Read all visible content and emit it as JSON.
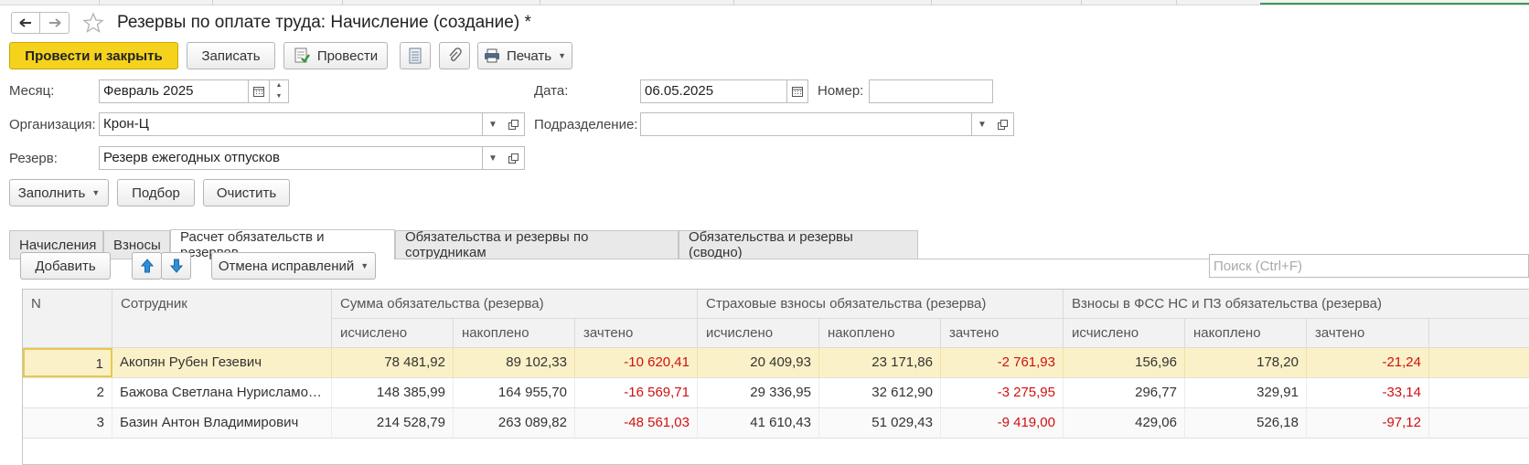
{
  "window": {
    "title": "Резервы по оплате труда: Начисление (создание) *"
  },
  "toolbar": {
    "post_close": "Провести и закрыть",
    "save": "Записать",
    "post": "Провести",
    "print": "Печать"
  },
  "form": {
    "month_label": "Месяц:",
    "month_value": "Февраль 2025",
    "date_label": "Дата:",
    "date_value": "06.05.2025",
    "number_label": "Номер:",
    "number_value": "",
    "org_label": "Организация:",
    "org_value": "Крон-Ц",
    "dept_label": "Подразделение:",
    "dept_value": "",
    "reserve_label": "Резерв:",
    "reserve_value": "Резерв ежегодных отпусков"
  },
  "actions": {
    "fill": "Заполнить",
    "pick": "Подбор",
    "clear": "Очистить"
  },
  "tabs": [
    "Начисления",
    "Взносы",
    "Расчет обязательств и резервов",
    "Обязательства и резервы по сотрудникам",
    "Обязательства и резервы (сводно)"
  ],
  "tab_toolbar": {
    "add": "Добавить",
    "undo_fixes": "Отмена исправлений",
    "search_placeholder": "Поиск (Ctrl+F)"
  },
  "table": {
    "headers": {
      "n": "N",
      "employee": "Сотрудник",
      "group1": "Сумма обязательства (резерва)",
      "group2": "Страховые взносы обязательства (резерва)",
      "group3": "Взносы в ФСС НС и ПЗ обязательства (резерва)",
      "calc": "исчислено",
      "accum": "накоплено",
      "offset": "зачтено"
    },
    "rows": [
      {
        "n": "1",
        "employee": "Акопян Рубен Гезевич",
        "v": [
          "78 481,92",
          "89 102,33",
          "-10 620,41",
          "20 409,93",
          "23 171,86",
          "-2 761,93",
          "156,96",
          "178,20",
          "-21,24"
        ]
      },
      {
        "n": "2",
        "employee": "Бажова Светлана Нурисламовна",
        "v": [
          "148 385,99",
          "164 955,70",
          "-16 569,71",
          "29 336,95",
          "32 612,90",
          "-3 275,95",
          "296,77",
          "329,91",
          "-33,14"
        ]
      },
      {
        "n": "3",
        "employee": "Базин Антон Владимирович",
        "v": [
          "214 528,79",
          "263 089,82",
          "-48 561,03",
          "41 610,43",
          "51 029,43",
          "-9 419,00",
          "429,06",
          "526,18",
          "-97,12"
        ]
      }
    ]
  }
}
